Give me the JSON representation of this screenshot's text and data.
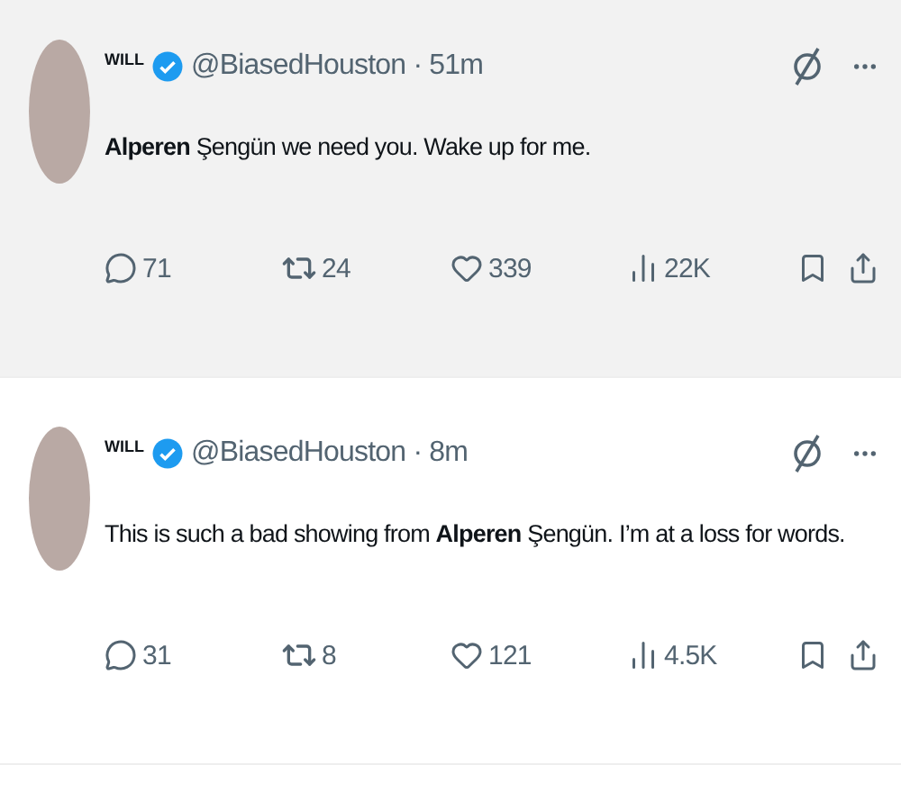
{
  "tweets": [
    {
      "hovered": true,
      "name": "WILL",
      "verified": true,
      "meta": "@BiasedHouston · 51m",
      "text": "**Alperen** Şengün we need you. Wake up for me.",
      "stats": {
        "replies": "71",
        "reposts": "24",
        "likes": "339",
        "views": "22K"
      }
    },
    {
      "hovered": false,
      "name": "WILL",
      "verified": true,
      "meta": "@BiasedHouston · 8m",
      "text": "This is such a bad showing from **Alperen** Şengün. I’m at a loss for words.",
      "stats": {
        "replies": "31",
        "reposts": "8",
        "likes": "121",
        "views": "4.5K"
      }
    }
  ]
}
